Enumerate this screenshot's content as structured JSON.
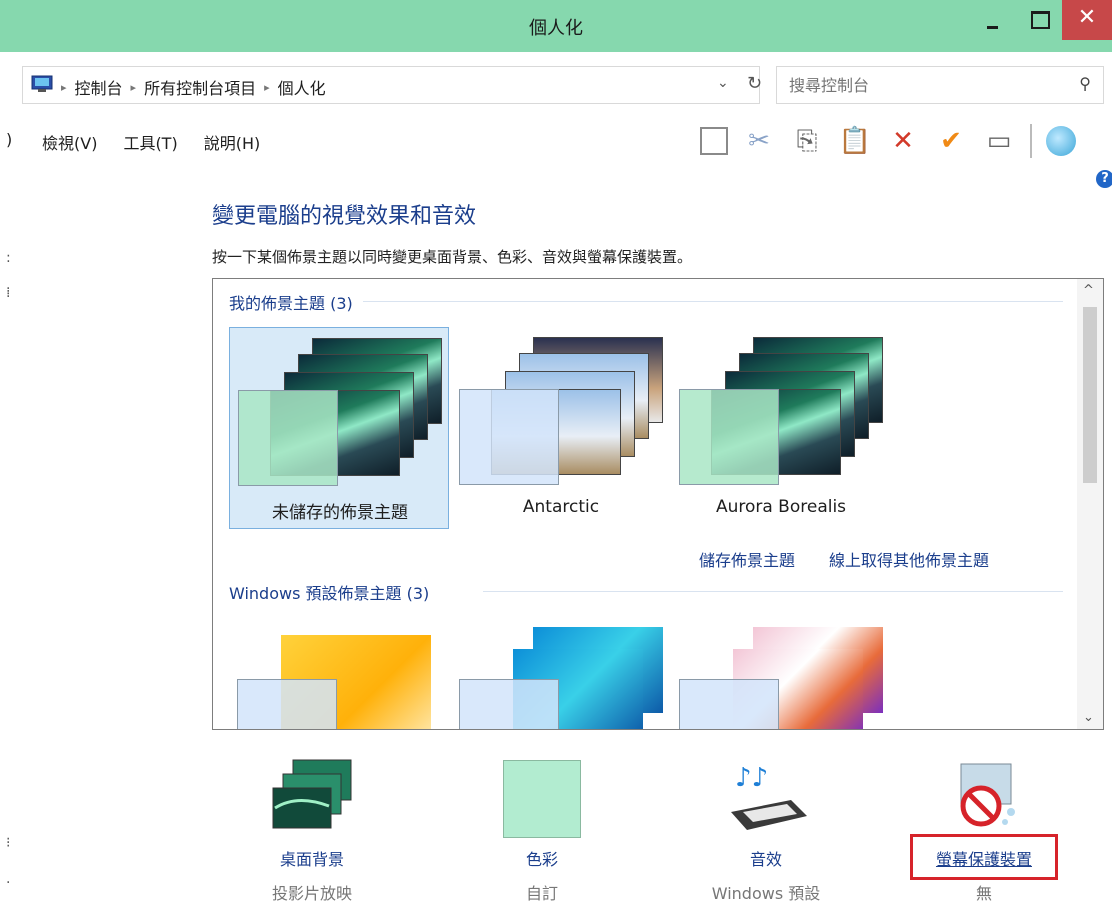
{
  "window": {
    "title": "個人化",
    "close_glyph": "✕"
  },
  "address": {
    "crumbs": [
      "控制台",
      "所有控制台項目",
      "個人化"
    ],
    "separator": "▸",
    "dropdown_glyph": "⌄",
    "refresh_glyph": "↻"
  },
  "search": {
    "placeholder": "搜尋控制台",
    "icon_glyph": "⚲"
  },
  "menu": {
    "lead": ")",
    "items": [
      "檢視(V)",
      "工具(T)",
      "說明(H)"
    ]
  },
  "toolbar": {
    "icons": [
      "pane-icon",
      "cut-icon",
      "copy-icon",
      "paste-icon",
      "delete-icon",
      "checkmark-icon",
      "properties-icon",
      "globe-icon"
    ],
    "cut_glyph": "✂",
    "copy_glyph": "⎘",
    "paste_glyph": "📋",
    "delete_glyph": "✕",
    "check_glyph": "✔",
    "props_glyph": "▭"
  },
  "help": {
    "glyph": "?"
  },
  "left_marks": [
    ":",
    "⁞",
    "⁝",
    "·"
  ],
  "content": {
    "heading": "變更電腦的視覺效果和音效",
    "subheading": "按一下某個佈景主題以同時變更桌面背景、色彩、音效與螢幕保護裝置。"
  },
  "themes": {
    "my_group_title": "我的佈景主題 (3)",
    "my_themes": [
      {
        "label": "未儲存的佈景主題",
        "selected": true
      },
      {
        "label": "Antarctic",
        "selected": false
      },
      {
        "label": "Aurora Borealis",
        "selected": false
      }
    ],
    "links": [
      "儲存佈景主題",
      "線上取得其他佈景主題"
    ],
    "windows_group_title": "Windows 預設佈景主題 (3)",
    "scroll_up_glyph": "^",
    "scroll_down_glyph": "⌄"
  },
  "options": [
    {
      "label": "桌面背景",
      "value": "投影片放映",
      "icon": "desktop-background-icon"
    },
    {
      "label": "色彩",
      "value": "自訂",
      "icon": "color-swatch-icon",
      "color": "#b2ecd0"
    },
    {
      "label": "音效",
      "value": "Windows 預設",
      "icon": "sound-keyboard-icon"
    },
    {
      "label": "螢幕保護裝置",
      "value": "無",
      "icon": "screensaver-icon"
    }
  ],
  "colors": {
    "titlebar": "#86d8ae",
    "close_button": "#c74849",
    "link_blue": "#1b3e8c",
    "highlight_red": "#d6232a"
  }
}
